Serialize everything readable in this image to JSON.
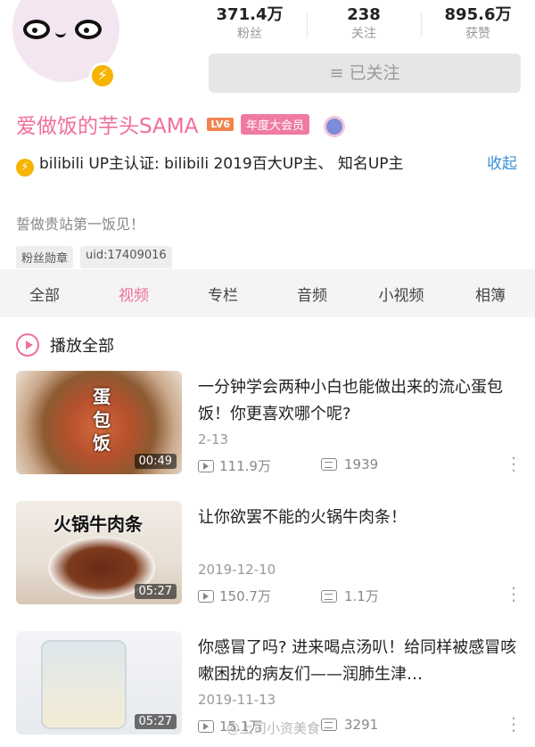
{
  "profile": {
    "stats": [
      {
        "value": "371.4万",
        "label": "粉丝"
      },
      {
        "value": "238",
        "label": "关注"
      },
      {
        "value": "895.6万",
        "label": "获赞"
      }
    ],
    "follow_label": "≡ 已关注",
    "name": "爱做饭的芋头SAMA",
    "level": "LV6",
    "vip": "年度大会员",
    "verified_badge": "⚡",
    "certification": "bilibili UP主认证: bilibili 2019百大UP主、 知名UP主",
    "collapse_label": "收起",
    "signature": "誓做贵站第一饭见！",
    "tags": [
      "粉丝勋章",
      "uid:17409016"
    ]
  },
  "tabs": [
    "全部",
    "视频",
    "专栏",
    "音频",
    "小视频",
    "相簿"
  ],
  "active_tab": "视频",
  "play_all_label": "播放全部",
  "videos": [
    {
      "title": "一分钟学会两种小白也能做出来的流心蛋包饭！你更喜欢哪个呢?",
      "date": "2-13",
      "views": "111.9万",
      "danmaku": "1939",
      "duration": "00:49",
      "caption": "蛋包饭"
    },
    {
      "title": "让你欲罢不能的火锅牛肉条！",
      "date": "2019-12-10",
      "views": "150.7万",
      "danmaku": "1.1万",
      "duration": "05:27",
      "caption": "火锅牛肉条"
    },
    {
      "title": "你感冒了吗? 进来喝点汤叭！给同样被感冒咳嗽困扰的病友们——润肺生津…",
      "date": "2019-11-13",
      "views": "15.1万",
      "danmaku": "3291",
      "duration": "05:27",
      "caption": ""
    }
  ],
  "watermark": "@上司小资美食",
  "colors": {
    "accent_pink": "#f06f98",
    "link_blue": "#3d8fd6",
    "tab_bg": "#f4f4f4"
  },
  "icons": [
    "verified-icon",
    "play-circle-icon",
    "play-count-icon",
    "danmaku-icon",
    "more-icon"
  ]
}
